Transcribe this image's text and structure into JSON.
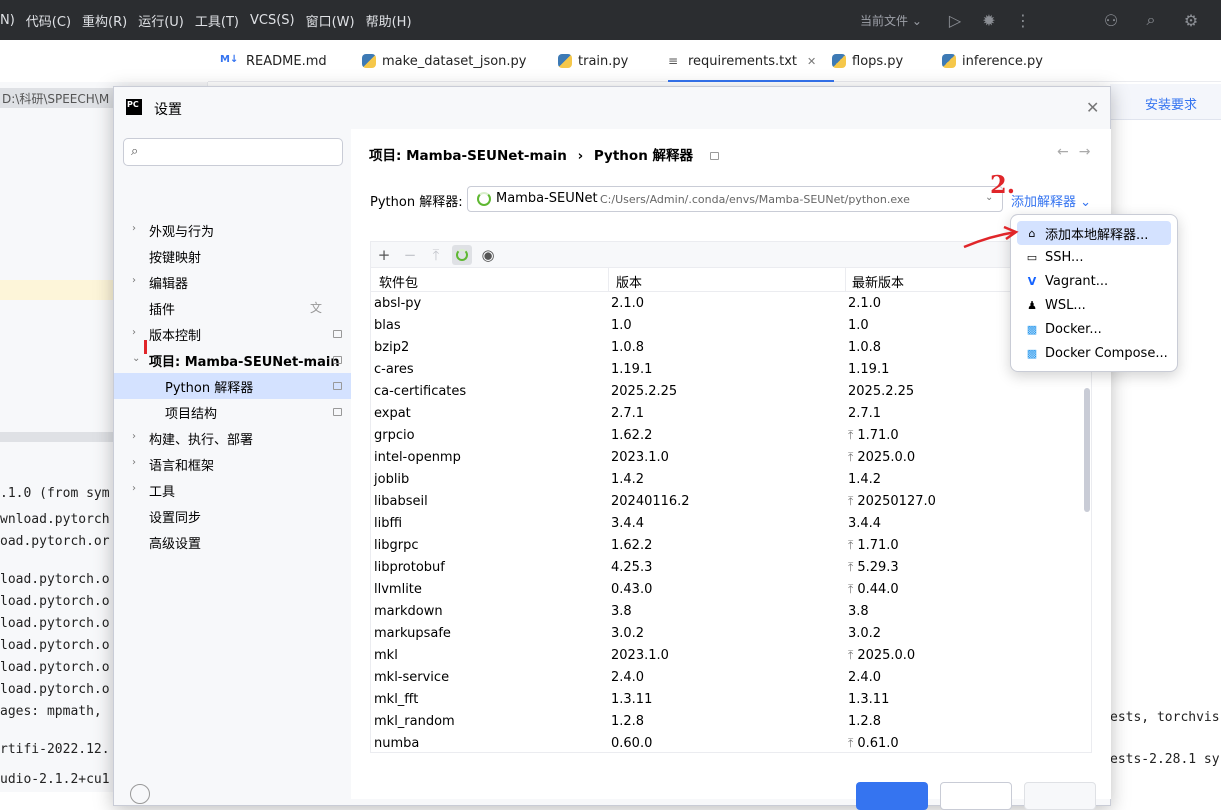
{
  "menubar": {
    "items": [
      "N)",
      "代码(C)",
      "重构(R)",
      "运行(U)",
      "工具(T)",
      "VCS(S)",
      "窗口(W)",
      "帮助(H)"
    ],
    "current_file": "当前文件 ⌄"
  },
  "tabs": [
    {
      "label": "README.md",
      "icon": "markdown-icon"
    },
    {
      "label": "make_dataset_json.py",
      "icon": "python-icon"
    },
    {
      "label": "train.py",
      "icon": "python-icon"
    },
    {
      "label": "requirements.txt",
      "icon": "text-file-icon",
      "close": "✕"
    },
    {
      "label": "flops.py",
      "icon": "python-icon"
    },
    {
      "label": "inference.py",
      "icon": "python-icon"
    }
  ],
  "left_path": "D:\\科研\\SPEECH\\M",
  "infobar_link": "安装要求",
  "console_lines": [
    ".1.0 (from sym",
    "wnload.pytorch",
    "oad.pytorch.or",
    "load.pytorch.o",
    "load.pytorch.o",
    "load.pytorch.o",
    "load.pytorch.o",
    "load.pytorch.o",
    "load.pytorch.o",
    "ages: mpmath,",
    "rtifi-2022.12.",
    "udio-2.1.2+cu1"
  ],
  "console_right": [
    "ests, torchvis",
    "ests-2.28.1 sy"
  ],
  "dialog": {
    "title": "设置",
    "search_placeholder": "",
    "nav": [
      {
        "label": "外观与行为",
        "arrow": "›",
        "level": 0,
        "page": false,
        "selected": false
      },
      {
        "label": "按键映射",
        "arrow": "",
        "level": 0,
        "page": false,
        "selected": false
      },
      {
        "label": "编辑器",
        "arrow": "›",
        "level": 0,
        "page": false,
        "selected": false
      },
      {
        "label": "插件",
        "arrow": "",
        "level": 0,
        "page": false,
        "selected": false,
        "translate": true
      },
      {
        "label": "版本控制",
        "arrow": "›",
        "level": 0,
        "page": true,
        "selected": false
      },
      {
        "label": "项目: Mamba-SEUNet-main",
        "arrow": "⌄",
        "level": 0,
        "page": true,
        "selected": false,
        "bold": true
      },
      {
        "label": "Python 解释器",
        "arrow": "",
        "level": 1,
        "page": true,
        "selected": true
      },
      {
        "label": "项目结构",
        "arrow": "",
        "level": 1,
        "page": true,
        "selected": false
      },
      {
        "label": "构建、执行、部署",
        "arrow": "›",
        "level": 0,
        "page": false,
        "selected": false
      },
      {
        "label": "语言和框架",
        "arrow": "›",
        "level": 0,
        "page": false,
        "selected": false
      },
      {
        "label": "工具",
        "arrow": "›",
        "level": 0,
        "page": false,
        "selected": false
      },
      {
        "label": "设置同步",
        "arrow": "",
        "level": 0,
        "page": false,
        "selected": false
      },
      {
        "label": "高级设置",
        "arrow": "",
        "level": 0,
        "page": false,
        "selected": false
      }
    ],
    "breadcrumb": {
      "parent": "项目: Mamba-SEUNet-main",
      "sep": "›",
      "current": "Python 解释器"
    },
    "interpreter_label": "Python 解释器:",
    "interpreter_name": "Mamba-SEUNet",
    "interpreter_path": "C:/Users/Admin/.conda/envs/Mamba-SEUNet/python.exe",
    "add_interpreter": "添加解释器 ⌄",
    "columns": [
      "软件包",
      "版本",
      "最新版本"
    ],
    "packages": [
      {
        "name": "absl-py",
        "version": "2.1.0",
        "latest": "2.1.0",
        "upgrade": false
      },
      {
        "name": "blas",
        "version": "1.0",
        "latest": "1.0",
        "upgrade": false
      },
      {
        "name": "bzip2",
        "version": "1.0.8",
        "latest": "1.0.8",
        "upgrade": false
      },
      {
        "name": "c-ares",
        "version": "1.19.1",
        "latest": "1.19.1",
        "upgrade": false
      },
      {
        "name": "ca-certificates",
        "version": "2025.2.25",
        "latest": "2025.2.25",
        "upgrade": false
      },
      {
        "name": "expat",
        "version": "2.7.1",
        "latest": "2.7.1",
        "upgrade": false
      },
      {
        "name": "grpcio",
        "version": "1.62.2",
        "latest": "1.71.0",
        "upgrade": true
      },
      {
        "name": "intel-openmp",
        "version": "2023.1.0",
        "latest": "2025.0.0",
        "upgrade": true
      },
      {
        "name": "joblib",
        "version": "1.4.2",
        "latest": "1.4.2",
        "upgrade": false
      },
      {
        "name": "libabseil",
        "version": "20240116.2",
        "latest": "20250127.0",
        "upgrade": true
      },
      {
        "name": "libffi",
        "version": "3.4.4",
        "latest": "3.4.4",
        "upgrade": false
      },
      {
        "name": "libgrpc",
        "version": "1.62.2",
        "latest": "1.71.0",
        "upgrade": true
      },
      {
        "name": "libprotobuf",
        "version": "4.25.3",
        "latest": "5.29.3",
        "upgrade": true
      },
      {
        "name": "llvmlite",
        "version": "0.43.0",
        "latest": "0.44.0",
        "upgrade": true
      },
      {
        "name": "markdown",
        "version": "3.8",
        "latest": "3.8",
        "upgrade": false
      },
      {
        "name": "markupsafe",
        "version": "3.0.2",
        "latest": "3.0.2",
        "upgrade": false
      },
      {
        "name": "mkl",
        "version": "2023.1.0",
        "latest": "2025.0.0",
        "upgrade": true
      },
      {
        "name": "mkl-service",
        "version": "2.4.0",
        "latest": "2.4.0",
        "upgrade": false
      },
      {
        "name": "mkl_fft",
        "version": "1.3.11",
        "latest": "1.3.11",
        "upgrade": false
      },
      {
        "name": "mkl_random",
        "version": "1.2.8",
        "latest": "1.2.8",
        "upgrade": false
      },
      {
        "name": "numba",
        "version": "0.60.0",
        "latest": "0.61.0",
        "upgrade": true
      }
    ],
    "add_menu": [
      {
        "label": "添加本地解释器...",
        "icon": "home-icon",
        "selected": true
      },
      {
        "label": "SSH...",
        "icon": "terminal-icon",
        "selected": false
      },
      {
        "label": "Vagrant...",
        "icon": "vagrant-icon",
        "selected": false
      },
      {
        "label": "WSL...",
        "icon": "linux-icon",
        "selected": false
      },
      {
        "label": "Docker...",
        "icon": "docker-icon",
        "selected": false
      },
      {
        "label": "Docker Compose...",
        "icon": "docker-compose-icon",
        "selected": false
      }
    ],
    "annotations": {
      "mark2": "2.",
      "mark_nav": "|"
    }
  },
  "colors": {
    "accent": "#3574f0",
    "menubar_bg": "#2b2d30",
    "selection": "#d4e2ff",
    "annotation": "#e0262a"
  }
}
